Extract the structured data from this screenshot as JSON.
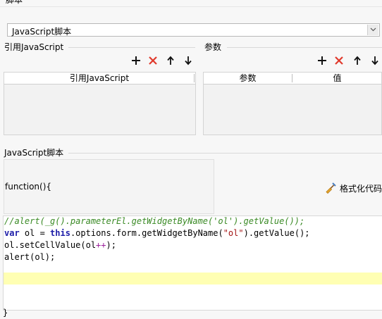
{
  "top_fragment": "脚本",
  "script_type_select": {
    "value": "JavaScript脚本"
  },
  "ref_js_group": {
    "title": "引用JavaScript",
    "grid": {
      "columns": [
        "引用JavaScript"
      ]
    }
  },
  "params_group": {
    "title": "参数",
    "grid": {
      "columns": [
        "参数",
        "值"
      ]
    }
  },
  "toolbar_icons": [
    "plus-icon",
    "delete-x-icon",
    "arrow-up-icon",
    "arrow-down-icon"
  ],
  "script_group": {
    "title": "JavaScript脚本",
    "function_label": "function(){",
    "format_button": "格式化代码",
    "closing_brace": "}"
  },
  "code_lines": [
    "//alert(_g().parameterEl.getWidgetByName('ol').getValue());",
    "var ol = this.options.form.getWidgetByName(\"ol\").getValue();",
    "ol.setCellValue(ol++);",
    "alert(ol);"
  ],
  "colors": {
    "delete_icon": "#e0392b",
    "comment": "#3a8a25",
    "keyword": "#1c1ca8",
    "string": "#a31515",
    "highlight_line": "#ffffb3"
  }
}
